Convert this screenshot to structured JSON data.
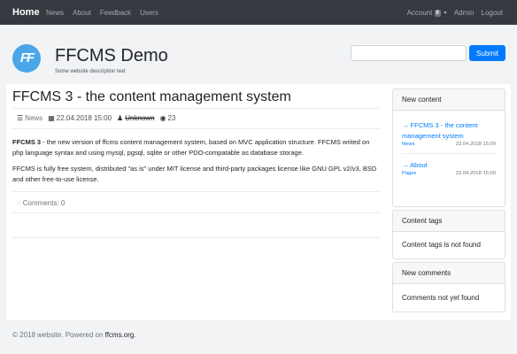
{
  "navbar": {
    "brand": "Home",
    "links": [
      "News",
      "About",
      "Feedback",
      "Users"
    ],
    "account_label": "Account",
    "account_badge": "0",
    "admin_label": "Admin",
    "logout_label": "Logout"
  },
  "header": {
    "logo_text": "FF",
    "title": "FFCMS Demo",
    "description": "Some website description text",
    "search_value": "",
    "search_button": "Submit"
  },
  "article": {
    "title": "FFCMS 3 - the content management system",
    "category": "News",
    "date": "22.04.2018 15:00",
    "author": "Unknown",
    "views": "23",
    "body_bold": "FFCMS 3",
    "body_p1": " - the new version of ffcms content management system, based on MVC application structure. FFCMS writed on php language syntax and using mysql, pgsql, sqlite or other PDO-compatable as database storage.",
    "body_p2": "FFCMS is fully free system, distributed \"as is\" under MIT license and third-party packages license like GNU GPL v2/v3, BSD and other free-to-use license.",
    "comments_label": "Comments: 0"
  },
  "sidebar": {
    "new_content": {
      "header": "New content",
      "items": [
        {
          "title": "→ FFCMS 3 - the content management system",
          "category": "News",
          "date": "22.04.2018 15:00"
        },
        {
          "title": "→ About",
          "category": "Pages",
          "date": "22.04.2018 15:00"
        }
      ]
    },
    "content_tags": {
      "header": "Content tags",
      "body": "Content tags is not found"
    },
    "new_comments": {
      "header": "New comments",
      "body": "Comments not yet found"
    }
  },
  "footer": {
    "prefix": "© 2018 website. Powered on ",
    "org": "ffcms.org",
    "suffix": "."
  }
}
